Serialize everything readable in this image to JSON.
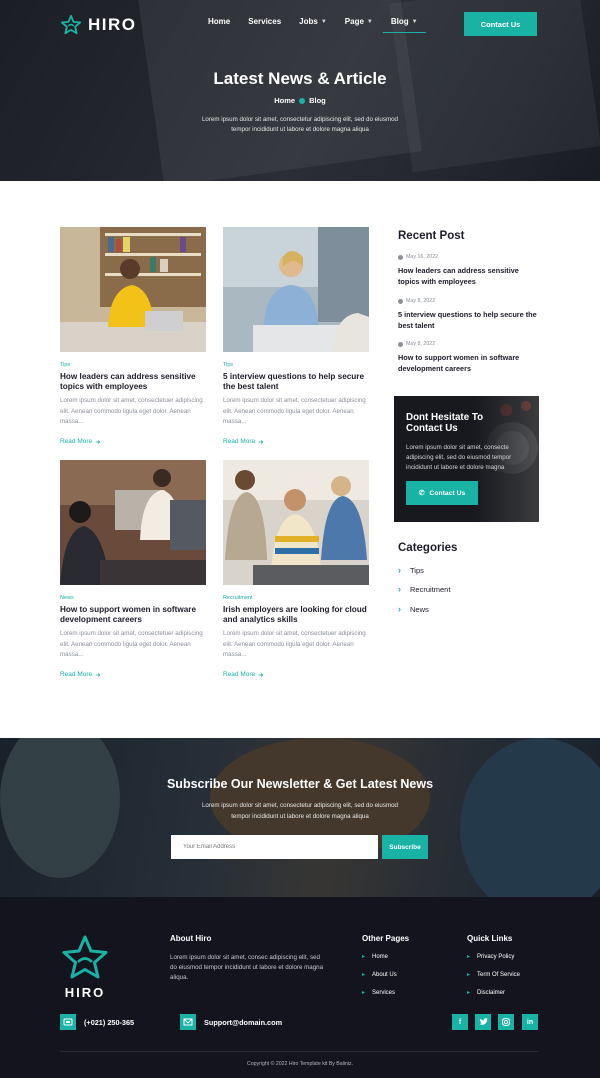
{
  "brand": {
    "name": "HIRO",
    "accent": "#19b3a6"
  },
  "nav": {
    "items": [
      {
        "label": "Home",
        "dropdown": false
      },
      {
        "label": "Services",
        "dropdown": false
      },
      {
        "label": "Jobs",
        "dropdown": true
      },
      {
        "label": "Page",
        "dropdown": true
      },
      {
        "label": "Blog",
        "dropdown": true,
        "active": true
      }
    ],
    "contact_label": "Contact Us"
  },
  "hero": {
    "title": "Latest News & Article",
    "breadcrumb": [
      "Home",
      "Blog"
    ],
    "subtitle": "Lorem ipsum dolor sit amet, consectetur adipiscing elit, sed do eiusmod tempor incididunt ut labore et dolore magna aliqua"
  },
  "posts": [
    {
      "tag": "Tips",
      "title": "How leaders can address sensitive topics with employees",
      "excerpt": "Lorem ipsum dolor sit amet, consectetuer adipiscing elit. Aenean commodo ligula eget dolor. Aenean massa...",
      "read_more": "Read More"
    },
    {
      "tag": "Tips",
      "title": "5 interview questions to help secure the best talent",
      "excerpt": "Lorem ipsum dolor sit amet, consectetuer adipiscing elit. Aenean commodo ligula eget dolor. Aenean massa...",
      "read_more": "Read More"
    },
    {
      "tag": "News",
      "title": "How to support women in software development careers",
      "excerpt": "Lorem ipsum dolor sit amet, consectetuer adipiscing elit. Aenean commodo ligula eget dolor. Aenean massa...",
      "read_more": "Read More"
    },
    {
      "tag": "Recruitment",
      "title": "Irish employers are looking for cloud and analytics skills",
      "excerpt": "Lorem ipsum dolor sit amet, consectetuer adipiscing elit. Aenean commodo ligula eget dolor. Aenean massa...",
      "read_more": "Read More"
    }
  ],
  "sidebar": {
    "recent_heading": "Recent Post",
    "recent": [
      {
        "date": "May 16, 2022",
        "title": "How leaders can address sensitive topics with employees"
      },
      {
        "date": "May 8, 2022",
        "title": "5 interview questions to help secure the best talent"
      },
      {
        "date": "May 8, 2022",
        "title": "How to support women in software development careers"
      }
    ],
    "cta": {
      "title": "Dont Hesitate To Contact Us",
      "text": "Lorem ipsum dolor sit amet, consecte adipiscing elit, sed do eiusmod tempor incididunt ut labore et dolore magna",
      "button": "Contact Us"
    },
    "categories_heading": "Categories",
    "categories": [
      "Tips",
      "Recruitment",
      "News"
    ]
  },
  "newsletter": {
    "title": "Subscribe Our Newsletter & Get Latest News",
    "subtitle": "Lorem ipsum dolor sit amet, consectetur adipiscing elit, sed do eiusmod tempor incididunt ut labore et dolore magna aliqua",
    "placeholder": "Your Email Address",
    "button": "Subscribe"
  },
  "footer": {
    "logo_text": "HIRO",
    "about_heading": "About Hiro",
    "about_text": "Lorem ipsum dolor sit amet, consec adipiscing elit, sed do eiusmod tempor incididunt ut labore et dolore magna aliqua.",
    "other_heading": "Other Pages",
    "other_links": [
      "Home",
      "About Us",
      "Services"
    ],
    "quick_heading": "Quick Links",
    "quick_links": [
      "Privacy Policy",
      "Term Of Service",
      "Disclaimer"
    ],
    "phone": "(+021) 250-365",
    "email": "Support@domain.com",
    "social_icons": [
      "facebook-icon",
      "twitter-icon",
      "instagram-icon",
      "linkedin-icon"
    ],
    "copyright": "Copyright © 2022 Hiro Template kit By Baliniz."
  }
}
